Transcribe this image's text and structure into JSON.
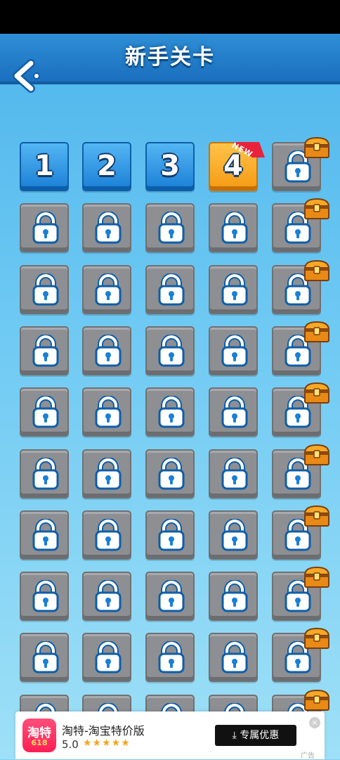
{
  "header": {
    "title": "新手关卡"
  },
  "colors": {
    "header": "#1f7ccb",
    "unlocked": "#1b7fd6",
    "current": "#f59a12",
    "locked": "#8d8f92",
    "background": "#6ec9f3"
  },
  "levels": [
    {
      "label": "1",
      "state": "unlocked",
      "chest": false
    },
    {
      "label": "2",
      "state": "unlocked",
      "chest": false
    },
    {
      "label": "3",
      "state": "unlocked",
      "chest": false
    },
    {
      "label": "4",
      "state": "current",
      "chest": false,
      "badge": "NEW"
    },
    {
      "label": "",
      "state": "locked",
      "chest": true
    },
    {
      "label": "",
      "state": "locked",
      "chest": false
    },
    {
      "label": "",
      "state": "locked",
      "chest": false
    },
    {
      "label": "",
      "state": "locked",
      "chest": false
    },
    {
      "label": "",
      "state": "locked",
      "chest": false
    },
    {
      "label": "",
      "state": "locked",
      "chest": true
    },
    {
      "label": "",
      "state": "locked",
      "chest": false
    },
    {
      "label": "",
      "state": "locked",
      "chest": false
    },
    {
      "label": "",
      "state": "locked",
      "chest": false
    },
    {
      "label": "",
      "state": "locked",
      "chest": false
    },
    {
      "label": "",
      "state": "locked",
      "chest": true
    },
    {
      "label": "",
      "state": "locked",
      "chest": false
    },
    {
      "label": "",
      "state": "locked",
      "chest": false
    },
    {
      "label": "",
      "state": "locked",
      "chest": false
    },
    {
      "label": "",
      "state": "locked",
      "chest": false
    },
    {
      "label": "",
      "state": "locked",
      "chest": true
    },
    {
      "label": "",
      "state": "locked",
      "chest": false
    },
    {
      "label": "",
      "state": "locked",
      "chest": false
    },
    {
      "label": "",
      "state": "locked",
      "chest": false
    },
    {
      "label": "",
      "state": "locked",
      "chest": false
    },
    {
      "label": "",
      "state": "locked",
      "chest": true
    },
    {
      "label": "",
      "state": "locked",
      "chest": false
    },
    {
      "label": "",
      "state": "locked",
      "chest": false
    },
    {
      "label": "",
      "state": "locked",
      "chest": false
    },
    {
      "label": "",
      "state": "locked",
      "chest": false
    },
    {
      "label": "",
      "state": "locked",
      "chest": true
    },
    {
      "label": "",
      "state": "locked",
      "chest": false
    },
    {
      "label": "",
      "state": "locked",
      "chest": false
    },
    {
      "label": "",
      "state": "locked",
      "chest": false
    },
    {
      "label": "",
      "state": "locked",
      "chest": false
    },
    {
      "label": "",
      "state": "locked",
      "chest": true
    },
    {
      "label": "",
      "state": "locked",
      "chest": false
    },
    {
      "label": "",
      "state": "locked",
      "chest": false
    },
    {
      "label": "",
      "state": "locked",
      "chest": false
    },
    {
      "label": "",
      "state": "locked",
      "chest": false
    },
    {
      "label": "",
      "state": "locked",
      "chest": true
    },
    {
      "label": "",
      "state": "locked",
      "chest": false
    },
    {
      "label": "",
      "state": "locked",
      "chest": false
    },
    {
      "label": "",
      "state": "locked",
      "chest": false
    },
    {
      "label": "",
      "state": "locked",
      "chest": false
    },
    {
      "label": "",
      "state": "locked",
      "chest": true
    },
    {
      "label": "",
      "state": "locked",
      "chest": false
    },
    {
      "label": "",
      "state": "locked",
      "chest": false
    },
    {
      "label": "",
      "state": "locked",
      "chest": false
    },
    {
      "label": "",
      "state": "locked",
      "chest": false
    },
    {
      "label": "",
      "state": "locked",
      "chest": true
    }
  ],
  "icons": {
    "back": "back-chevron-icon",
    "lock": "lock-icon",
    "chest": "treasure-chest-icon"
  },
  "ad": {
    "app_icon_text": "淘特",
    "app_icon_sub": "618",
    "name": "淘特-淘宝特价版",
    "rating": "5.0",
    "stars": "★★★★★",
    "button": "专属优惠",
    "close": "×",
    "tag": "广告"
  }
}
